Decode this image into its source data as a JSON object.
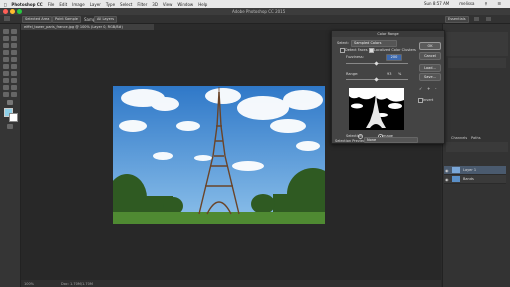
{
  "mac_menu": {
    "app_name": "Photoshop CC",
    "items": [
      "File",
      "Edit",
      "Image",
      "Layer",
      "Type",
      "Select",
      "Filter",
      "3D",
      "View",
      "Window",
      "Help"
    ],
    "clock": "Sun 8:57 AM",
    "user": "melissa"
  },
  "window_title": "Adobe Photoshop CC 2015",
  "options_bar": {
    "selection_label": "Selected Area",
    "sample_size": "Point Sample",
    "sample_label": "Sample:",
    "sample_value": "All Layers",
    "essentials": "Essentials"
  },
  "document_tab": "eiffel_tower_paris_france.jpg @ 100% (Layer 0, RGB/8#)",
  "status": {
    "zoom": "100%",
    "doc": "Doc: 1.70M/1.70M"
  },
  "color_range": {
    "title": "Color Range",
    "select_label": "Select:",
    "select_value": "Sampled Colors",
    "detect_faces": "Detect Faces",
    "localized": "Localized Color Clusters",
    "fuzziness_label": "Fuzziness:",
    "fuzziness_value": "200",
    "range_label": "Range:",
    "range_value": "93",
    "range_unit": "%",
    "ok": "OK",
    "cancel": "Cancel",
    "load": "Load...",
    "save": "Save...",
    "invert": "Invert",
    "radio_selection": "Selection",
    "radio_image": "Image",
    "preview_label": "Selection Preview:",
    "preview_value": "None"
  },
  "panels": {
    "tabs": [
      "Channels",
      "Paths"
    ],
    "layers": [
      {
        "name": "Layer 1",
        "selected": true
      },
      {
        "name": "Bands",
        "selected": false
      }
    ]
  }
}
